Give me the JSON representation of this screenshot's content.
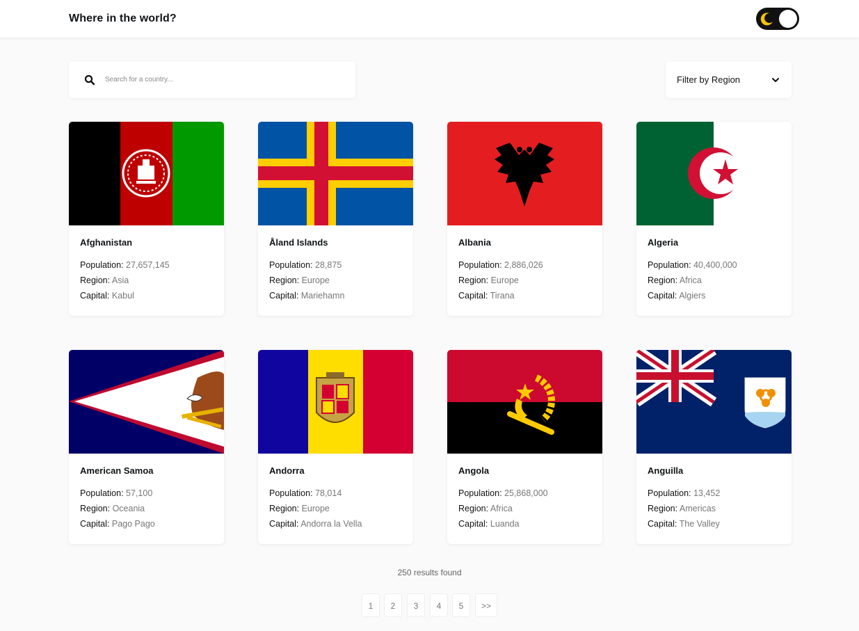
{
  "header": {
    "title": "Where in the world?"
  },
  "search": {
    "placeholder": "Search for a country..."
  },
  "filter": {
    "label": "Filter by Region"
  },
  "labels": {
    "population": "Population:",
    "region": "Region:",
    "capital": "Capital:"
  },
  "countries": [
    {
      "name": "Afghanistan",
      "population": "27,657,145",
      "region": "Asia",
      "capital": "Kabul"
    },
    {
      "name": "Åland Islands",
      "population": "28,875",
      "region": "Europe",
      "capital": "Mariehamn"
    },
    {
      "name": "Albania",
      "population": "2,886,026",
      "region": "Europe",
      "capital": "Tirana"
    },
    {
      "name": "Algeria",
      "population": "40,400,000",
      "region": "Africa",
      "capital": "Algiers"
    },
    {
      "name": "American Samoa",
      "population": "57,100",
      "region": "Oceania",
      "capital": "Pago Pago"
    },
    {
      "name": "Andorra",
      "population": "78,014",
      "region": "Europe",
      "capital": "Andorra la Vella"
    },
    {
      "name": "Angola",
      "population": "25,868,000",
      "region": "Africa",
      "capital": "Luanda"
    },
    {
      "name": "Anguilla",
      "population": "13,452",
      "region": "Americas",
      "capital": "The Valley"
    }
  ],
  "results": {
    "text": "250 results found"
  },
  "pagination": {
    "pages": [
      "1",
      "2",
      "3",
      "4",
      "5"
    ],
    "next": ">>"
  },
  "colors": {
    "background": "#fafafa",
    "toggle": "#111111",
    "moon": "#f5c400"
  }
}
